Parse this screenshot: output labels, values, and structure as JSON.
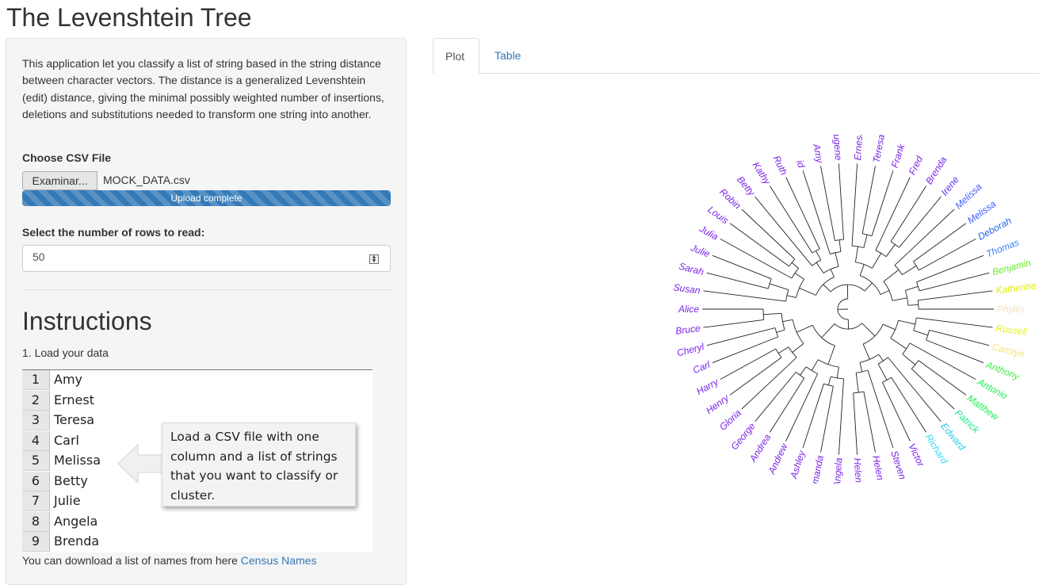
{
  "app": {
    "title": "The Levenshtein Tree"
  },
  "sidebar": {
    "intro": "This application let you classify a list of string based in the string distance between character vectors. The distance is a generalized Levenshtein (edit) distance, giving the minimal possibly weighted number of insertions, deletions and substitutions needed to transform one string into another.",
    "file_label": "Choose CSV File",
    "browse_label": "Examinar...",
    "file_name": "MOCK_DATA.csv",
    "upload_status": "Upload complete",
    "upload_progress": 1.0,
    "rows_label": "Select the number of rows to read:",
    "rows_value": "50"
  },
  "instructions": {
    "title": "Instructions",
    "step1": "1. Load your data",
    "sample_rows": [
      {
        "n": "1",
        "name": "Amy"
      },
      {
        "n": "2",
        "name": "Ernest"
      },
      {
        "n": "3",
        "name": "Teresa"
      },
      {
        "n": "4",
        "name": "Carl"
      },
      {
        "n": "5",
        "name": "Melissa"
      },
      {
        "n": "6",
        "name": "Betty"
      },
      {
        "n": "7",
        "name": "Julie"
      },
      {
        "n": "8",
        "name": "Angela"
      },
      {
        "n": "9",
        "name": "Brenda"
      }
    ],
    "callout": "Load a CSV file with one column and a list of strings that you want to classify or cluster.",
    "download_text": "You can download a list of names from here",
    "download_link": "Census Names"
  },
  "tabs": [
    {
      "label": "Plot",
      "active": true
    },
    {
      "label": "Table",
      "active": false
    }
  ],
  "dendrogram": {
    "leaves": [
      {
        "name": "Phyllis",
        "color": "#f2dfc4"
      },
      {
        "name": "Katherine",
        "color": "#e0f000"
      },
      {
        "name": "Benjamin",
        "color": "#66ee22"
      },
      {
        "name": "Thomas",
        "color": "#3b82f6"
      },
      {
        "name": "Deborah",
        "color": "#2563eb"
      },
      {
        "name": "Melissa",
        "color": "#3d5afe"
      },
      {
        "name": "Melissa",
        "color": "#3d5afe"
      },
      {
        "name": "Irene",
        "color": "#5b2ee8"
      },
      {
        "name": "Brenda",
        "color": "#7b22e8"
      },
      {
        "name": "Fred",
        "color": "#7b22e8"
      },
      {
        "name": "Frank",
        "color": "#7b22e8"
      },
      {
        "name": "Teresa",
        "color": "#7b22e8"
      },
      {
        "name": "Ernest",
        "color": "#7b22e8"
      },
      {
        "name": "Eugene",
        "color": "#7b22e8"
      },
      {
        "name": "Amy",
        "color": "#7b22e8"
      },
      {
        "name": "id",
        "color": "#7b22e8"
      },
      {
        "name": "Ruth",
        "color": "#7b22e8"
      },
      {
        "name": "Kathy",
        "color": "#7b22e8"
      },
      {
        "name": "Betty",
        "color": "#7b22e8"
      },
      {
        "name": "Robin",
        "color": "#7b22e8"
      },
      {
        "name": "Louis",
        "color": "#7b22e8"
      },
      {
        "name": "Julia",
        "color": "#7b22e8"
      },
      {
        "name": "Julie",
        "color": "#7b22e8"
      },
      {
        "name": "Sarah",
        "color": "#7b22e8"
      },
      {
        "name": "Susan",
        "color": "#7b22e8"
      },
      {
        "name": "Alice",
        "color": "#7b22e8"
      },
      {
        "name": "Bruce",
        "color": "#7b22e8"
      },
      {
        "name": "Cheryl",
        "color": "#7b22e8"
      },
      {
        "name": "Carl",
        "color": "#7b22e8"
      },
      {
        "name": "Harry",
        "color": "#7b22e8"
      },
      {
        "name": "Henry",
        "color": "#7b22e8"
      },
      {
        "name": "Gloria",
        "color": "#7b22e8"
      },
      {
        "name": "George",
        "color": "#7b22e8"
      },
      {
        "name": "Andrea",
        "color": "#7b22e8"
      },
      {
        "name": "Andrew",
        "color": "#7b22e8"
      },
      {
        "name": "Ashley",
        "color": "#7b22e8"
      },
      {
        "name": "Amanda",
        "color": "#7b22e8"
      },
      {
        "name": "Angela",
        "color": "#7b22e8"
      },
      {
        "name": "Helen",
        "color": "#7b22e8"
      },
      {
        "name": "Helen",
        "color": "#7b22e8"
      },
      {
        "name": "Steven",
        "color": "#7b22e8"
      },
      {
        "name": "Victor",
        "color": "#7b22e8"
      },
      {
        "name": "Richard",
        "color": "#33ddf0"
      },
      {
        "name": "Edward",
        "color": "#22ccee"
      },
      {
        "name": "Patrick",
        "color": "#22e888"
      },
      {
        "name": "Matthew",
        "color": "#22ee55"
      },
      {
        "name": "Antonio",
        "color": "#22ee55"
      },
      {
        "name": "Anthony",
        "color": "#44ee44"
      },
      {
        "name": "Carolyn",
        "color": "#f3e27a"
      },
      {
        "name": "Russell",
        "color": "#e8f020"
      }
    ]
  }
}
